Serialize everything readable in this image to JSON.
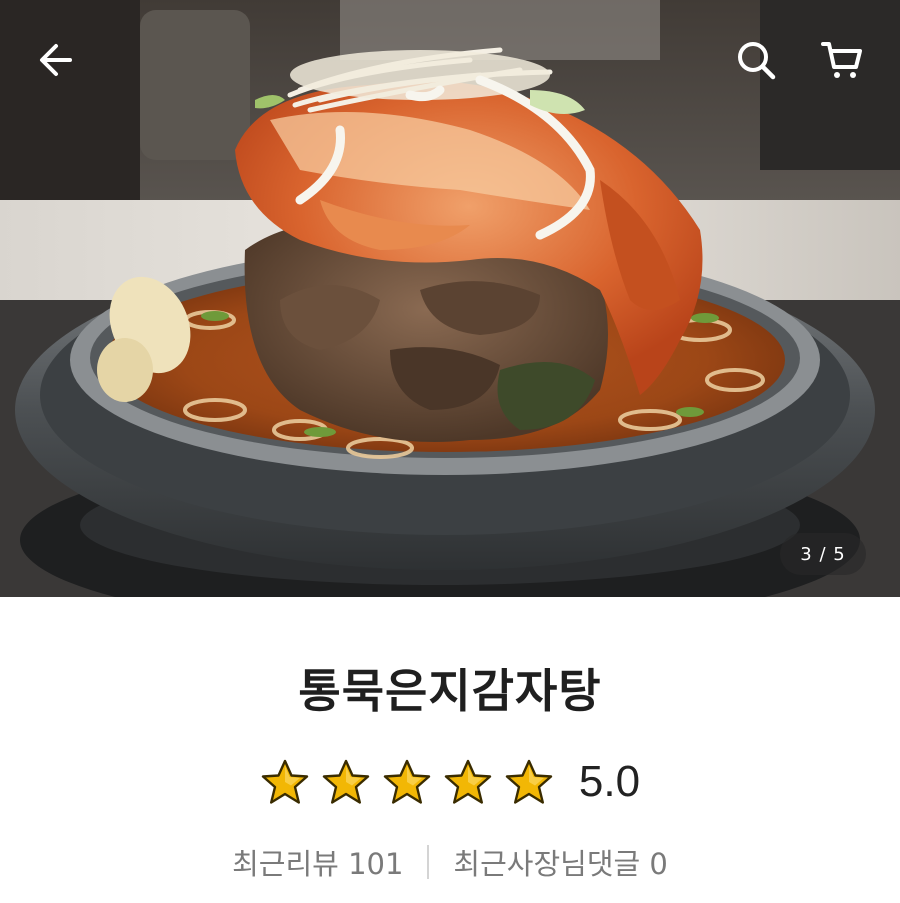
{
  "header": {
    "back_icon": "arrow-left-icon",
    "search_icon": "search-icon",
    "cart_icon": "cart-icon"
  },
  "gallery": {
    "image_subject": "photo",
    "counter": "3 / 5",
    "current": 3,
    "total": 5
  },
  "menu": {
    "name": "통묵은지감자탕",
    "rating_value": 5.0,
    "rating_text": "5.0",
    "star_color": "#F2B705",
    "recent_reviews_label": "최근리뷰 101",
    "owner_replies_label": "최근사장님댓글 0"
  }
}
